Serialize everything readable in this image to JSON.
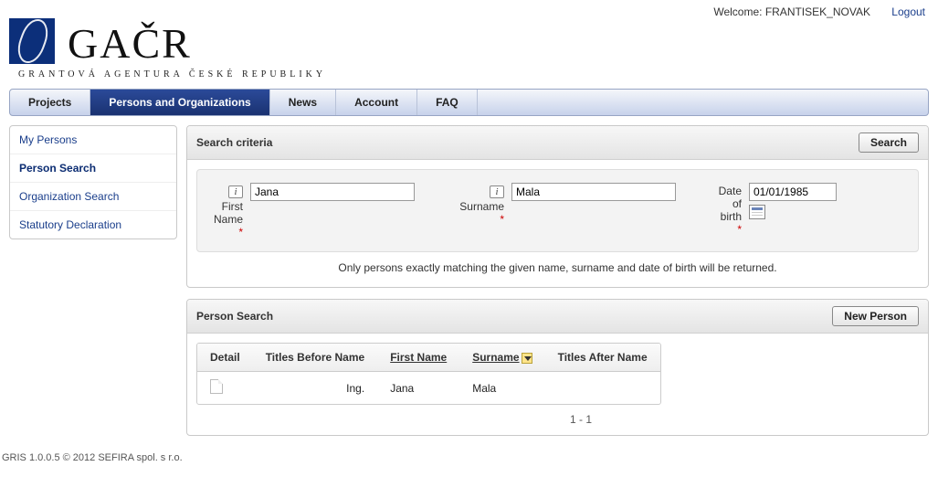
{
  "topbar": {
    "welcome_label": "Welcome:",
    "username": "FRANTISEK_NOVAK",
    "logout": "Logout"
  },
  "logo": {
    "main": "GAČR",
    "sub": "GRANTOVÁ AGENTURA ČESKÉ REPUBLIKY"
  },
  "menu": {
    "projects": "Projects",
    "persons": "Persons and Organizations",
    "news": "News",
    "account": "Account",
    "faq": "FAQ"
  },
  "sidebar": {
    "my_persons": "My Persons",
    "person_search": "Person Search",
    "organization_search": "Organization Search",
    "statutory_declaration": "Statutory Declaration"
  },
  "criteria": {
    "title": "Search criteria",
    "search_btn": "Search",
    "first_name_label": "First Name",
    "first_name_value": "Jana",
    "surname_label": "Surname",
    "surname_value": "Mala",
    "dob_label1": "Date",
    "dob_label2": "of",
    "dob_label3": "birth",
    "dob_value": "01/01/1985",
    "note": "Only persons exactly matching the given name, surname and date of birth will be returned.",
    "asterisk": "*"
  },
  "results": {
    "title": "Person Search",
    "new_person_btn": "New Person",
    "cols": {
      "detail": "Detail",
      "titles_before": "Titles Before Name",
      "first_name": "First Name",
      "surname": "Surname",
      "titles_after": "Titles After Name"
    },
    "row": {
      "titles_before": "Ing.",
      "first_name": "Jana",
      "surname": "Mala",
      "titles_after": ""
    },
    "pager": "1 - 1"
  },
  "footer": "GRIS 1.0.0.5 © 2012 SEFIRA spol. s r.o."
}
